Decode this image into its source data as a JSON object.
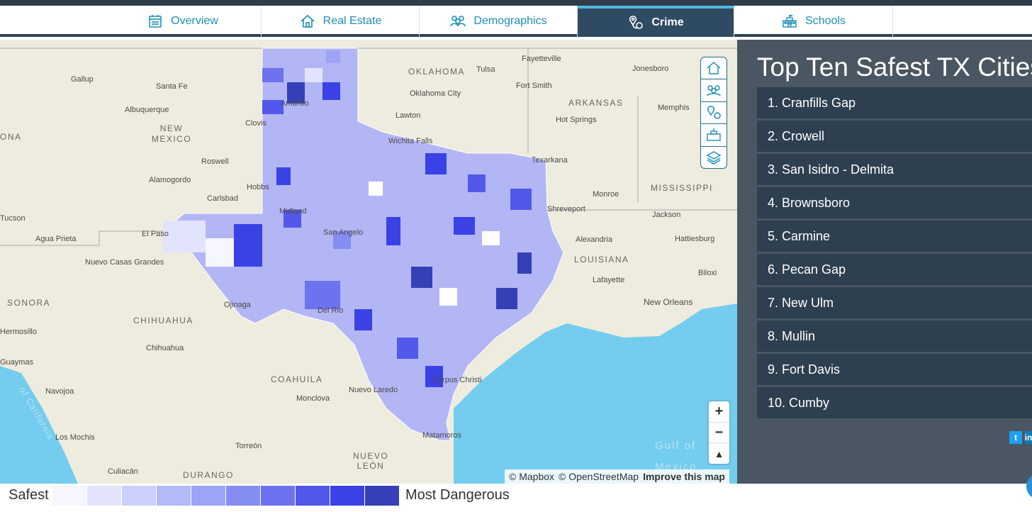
{
  "tabs": [
    {
      "label": "Overview",
      "icon": "calendar-icon",
      "active": false
    },
    {
      "label": "Real Estate",
      "icon": "house-icon",
      "active": false
    },
    {
      "label": "Demographics",
      "icon": "people-icon",
      "active": false
    },
    {
      "label": "Crime",
      "icon": "map-pin-icon",
      "active": true
    },
    {
      "label": "Schools",
      "icon": "school-icon",
      "active": false
    }
  ],
  "map": {
    "places": [
      "Gallup",
      "Santa Fe",
      "Albuquerque",
      "Roswell",
      "Alamogordo",
      "Carlsbad",
      "Clovis",
      "Hobbs",
      "El Paso",
      "Tucson",
      "Agua Prieta",
      "Nuevo Casas Grandes",
      "Chihuahua",
      "Ojinaga",
      "Guaymas",
      "Hermosillo",
      "Navojoa",
      "Los Mochis",
      "Culiacán",
      "Torreón",
      "Monclova",
      "Nuevo Laredo",
      "Fayetteville",
      "Tulsa",
      "Oklahoma City",
      "Lawton",
      "Fort Smith",
      "Hot Springs",
      "Jonesboro",
      "Memphis",
      "Texarkana",
      "Shreveport",
      "Monroe",
      "Jackson",
      "Alexandria",
      "Hattiesburg",
      "Lafayette",
      "Biloxi",
      "New Orleans",
      "Wichita Falls",
      "Corpus Christi",
      "Matamoros",
      "Del Rio",
      "Amarillo",
      "Midland",
      "San Angelo"
    ],
    "regions": [
      "OKLAHOMA",
      "ARKANSAS",
      "NEW MEXICO",
      "MISSISSIPPI",
      "LOUISIANA",
      "SONORA",
      "CHIHUAHUA",
      "COAHUILA",
      "NUEVO LEÓN",
      "DURANGO",
      "ONA",
      "of California"
    ],
    "water": [
      "Gulf of",
      "Mexico"
    ],
    "layer_controls": [
      "house-icon",
      "people-icon",
      "map-pin-icon",
      "school-icon",
      "layers-icon"
    ],
    "zoom": {
      "in": "+",
      "out": "−",
      "compass": "▲"
    },
    "attribution": [
      "© Mapbox",
      "© OpenStreetMap",
      "Improve this map"
    ]
  },
  "panel": {
    "title": "Top Ten Safest TX Cities",
    "cities": [
      "1. Cranfills Gap",
      "2. Crowell",
      "3. San Isidro - Delmita",
      "4. Brownsboro",
      "5. Carmine",
      "6. Pecan Gap",
      "7. New Ulm",
      "8. Mullin",
      "9. Fort Davis",
      "10. Cumby"
    ],
    "social": [
      "t",
      "in"
    ]
  },
  "legend": {
    "low_label": "Safest",
    "high_label": "Most Dangerous",
    "colors": [
      "#f5f6ff",
      "#e2e4fd",
      "#cbcffb",
      "#b4b9f8",
      "#9da3f5",
      "#868df2",
      "#6d73ee",
      "#5158ea",
      "#3a42e6",
      "#3640b6"
    ]
  }
}
